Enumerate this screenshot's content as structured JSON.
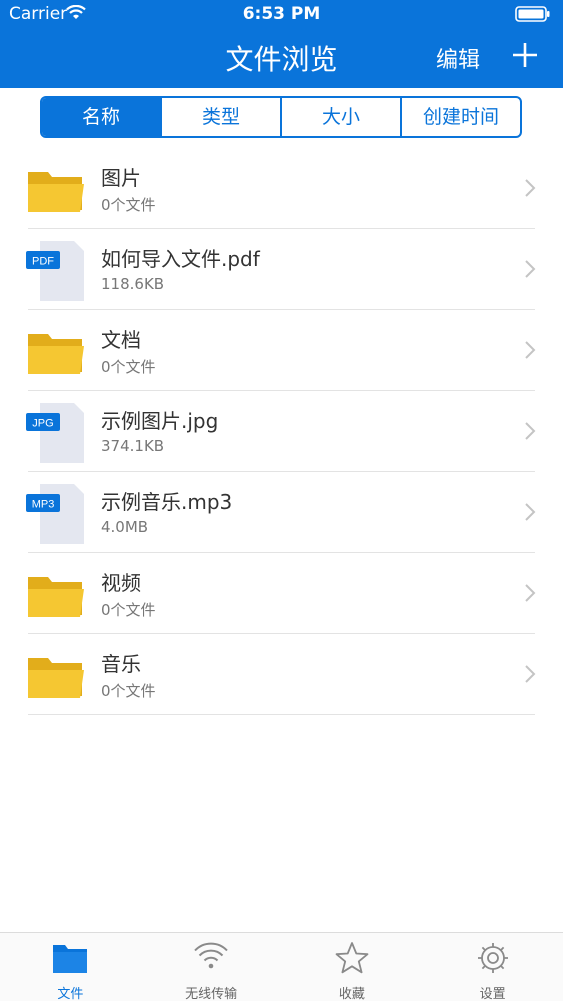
{
  "status_bar": {
    "carrier": "Carrier",
    "time": "6:53 PM"
  },
  "nav": {
    "title": "文件浏览",
    "edit_label": "编辑"
  },
  "sort_tabs": [
    {
      "label": "名称",
      "active": true
    },
    {
      "label": "类型",
      "active": false
    },
    {
      "label": "大小",
      "active": false
    },
    {
      "label": "创建时间",
      "active": false
    }
  ],
  "files": [
    {
      "name": "图片",
      "meta": "0个文件",
      "icon": "folder-icon"
    },
    {
      "name": "如何导入文件.pdf",
      "meta": "118.6KB",
      "icon": "pdf-file-icon",
      "badge": "PDF"
    },
    {
      "name": "文档",
      "meta": "0个文件",
      "icon": "folder-icon"
    },
    {
      "name": "示例图片.jpg",
      "meta": "374.1KB",
      "icon": "jpg-file-icon",
      "badge": "JPG"
    },
    {
      "name": "示例音乐.mp3",
      "meta": "4.0MB",
      "icon": "mp3-file-icon",
      "badge": "MP3"
    },
    {
      "name": "视频",
      "meta": "0个文件",
      "icon": "folder-icon"
    },
    {
      "name": "音乐",
      "meta": "0个文件",
      "icon": "folder-icon"
    }
  ],
  "tab_bar": [
    {
      "label": "文件",
      "icon": "folder-icon",
      "active": true
    },
    {
      "label": "无线传输",
      "icon": "wifi-icon",
      "active": false
    },
    {
      "label": "收藏",
      "icon": "star-icon",
      "active": false
    },
    {
      "label": "设置",
      "icon": "gear-icon",
      "active": false
    }
  ],
  "colors": {
    "accent": "#0a74da",
    "folder": "#f5c732",
    "text": "#333333",
    "muted": "#777777"
  }
}
